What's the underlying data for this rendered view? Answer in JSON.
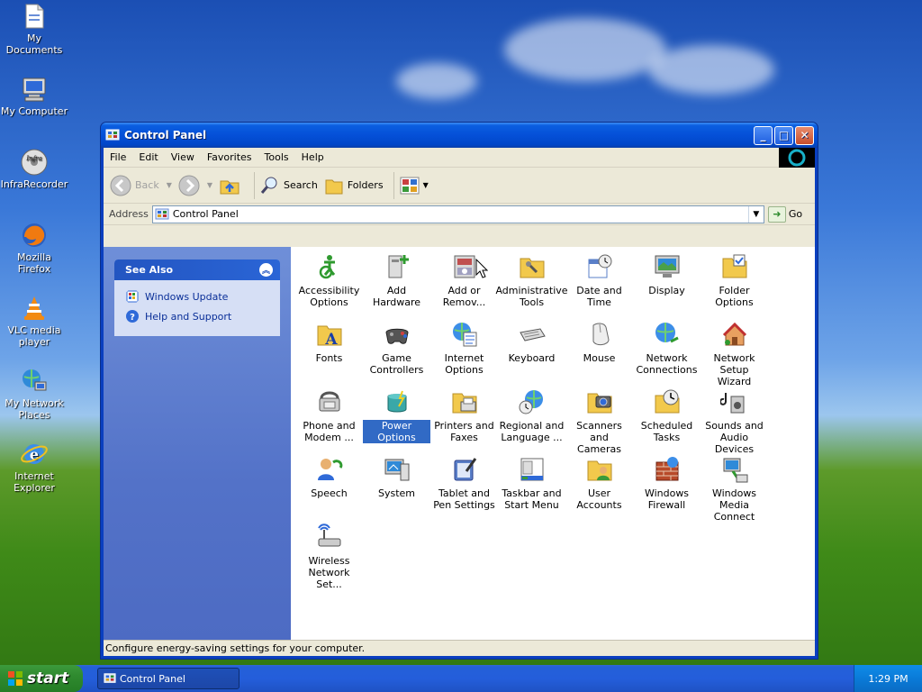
{
  "desktop": {
    "icons": [
      {
        "label": "My Documents"
      },
      {
        "label": "My Computer"
      },
      {
        "label": "InfraRecorder"
      },
      {
        "label": "Mozilla Firefox"
      },
      {
        "label": "VLC media player"
      },
      {
        "label": "My Network Places"
      },
      {
        "label": "Internet Explorer"
      }
    ]
  },
  "window": {
    "title": "Control Panel",
    "menu": [
      "File",
      "Edit",
      "View",
      "Favorites",
      "Tools",
      "Help"
    ],
    "toolbar": {
      "back": "Back",
      "search": "Search",
      "folders": "Folders"
    },
    "address": {
      "label": "Address",
      "value": "Control Panel",
      "go": "Go"
    },
    "see_also": {
      "title": "See Also",
      "links": [
        {
          "label": "Windows Update"
        },
        {
          "label": "Help and Support"
        }
      ]
    },
    "items": [
      {
        "label": "Accessibility Options",
        "icon": "accessibility-icon"
      },
      {
        "label": "Add Hardware",
        "icon": "add-hardware-icon"
      },
      {
        "label": "Add or Remov...",
        "icon": "add-remove-programs-icon"
      },
      {
        "label": "Administrative Tools",
        "icon": "administrative-tools-icon"
      },
      {
        "label": "Date and Time",
        "icon": "date-time-icon"
      },
      {
        "label": "Display",
        "icon": "display-icon"
      },
      {
        "label": "Folder Options",
        "icon": "folder-options-icon"
      },
      {
        "label": "Fonts",
        "icon": "fonts-icon"
      },
      {
        "label": "Game Controllers",
        "icon": "game-controllers-icon"
      },
      {
        "label": "Internet Options",
        "icon": "internet-options-icon"
      },
      {
        "label": "Keyboard",
        "icon": "keyboard-icon"
      },
      {
        "label": "Mouse",
        "icon": "mouse-icon"
      },
      {
        "label": "Network Connections",
        "icon": "network-connections-icon"
      },
      {
        "label": "Network Setup Wizard",
        "icon": "network-setup-wizard-icon"
      },
      {
        "label": "Phone and Modem ...",
        "icon": "phone-modem-icon"
      },
      {
        "label": "Power Options",
        "icon": "power-options-icon"
      },
      {
        "label": "Printers and Faxes",
        "icon": "printers-faxes-icon"
      },
      {
        "label": "Regional and Language ...",
        "icon": "regional-language-icon"
      },
      {
        "label": "Scanners and Cameras",
        "icon": "scanners-cameras-icon"
      },
      {
        "label": "Scheduled Tasks",
        "icon": "scheduled-tasks-icon"
      },
      {
        "label": "Sounds and Audio Devices",
        "icon": "sounds-audio-icon"
      },
      {
        "label": "Speech",
        "icon": "speech-icon"
      },
      {
        "label": "System",
        "icon": "system-icon"
      },
      {
        "label": "Tablet and Pen Settings",
        "icon": "tablet-pen-icon"
      },
      {
        "label": "Taskbar and Start Menu",
        "icon": "taskbar-start-menu-icon"
      },
      {
        "label": "User Accounts",
        "icon": "user-accounts-icon"
      },
      {
        "label": "Windows Firewall",
        "icon": "windows-firewall-icon"
      },
      {
        "label": "Windows Media Connect",
        "icon": "windows-media-connect-icon"
      },
      {
        "label": "Wireless Network Set...",
        "icon": "wireless-network-setup-icon"
      }
    ],
    "selected_item": "Power Options",
    "status": "Configure energy-saving settings for your computer."
  },
  "taskbar": {
    "start_label": "start",
    "task": "Control Panel",
    "clock": "1:29 PM"
  },
  "colors": {
    "title_blue": "#0550d8",
    "selection": "#316ac5",
    "left_pane": "#5372c8"
  }
}
